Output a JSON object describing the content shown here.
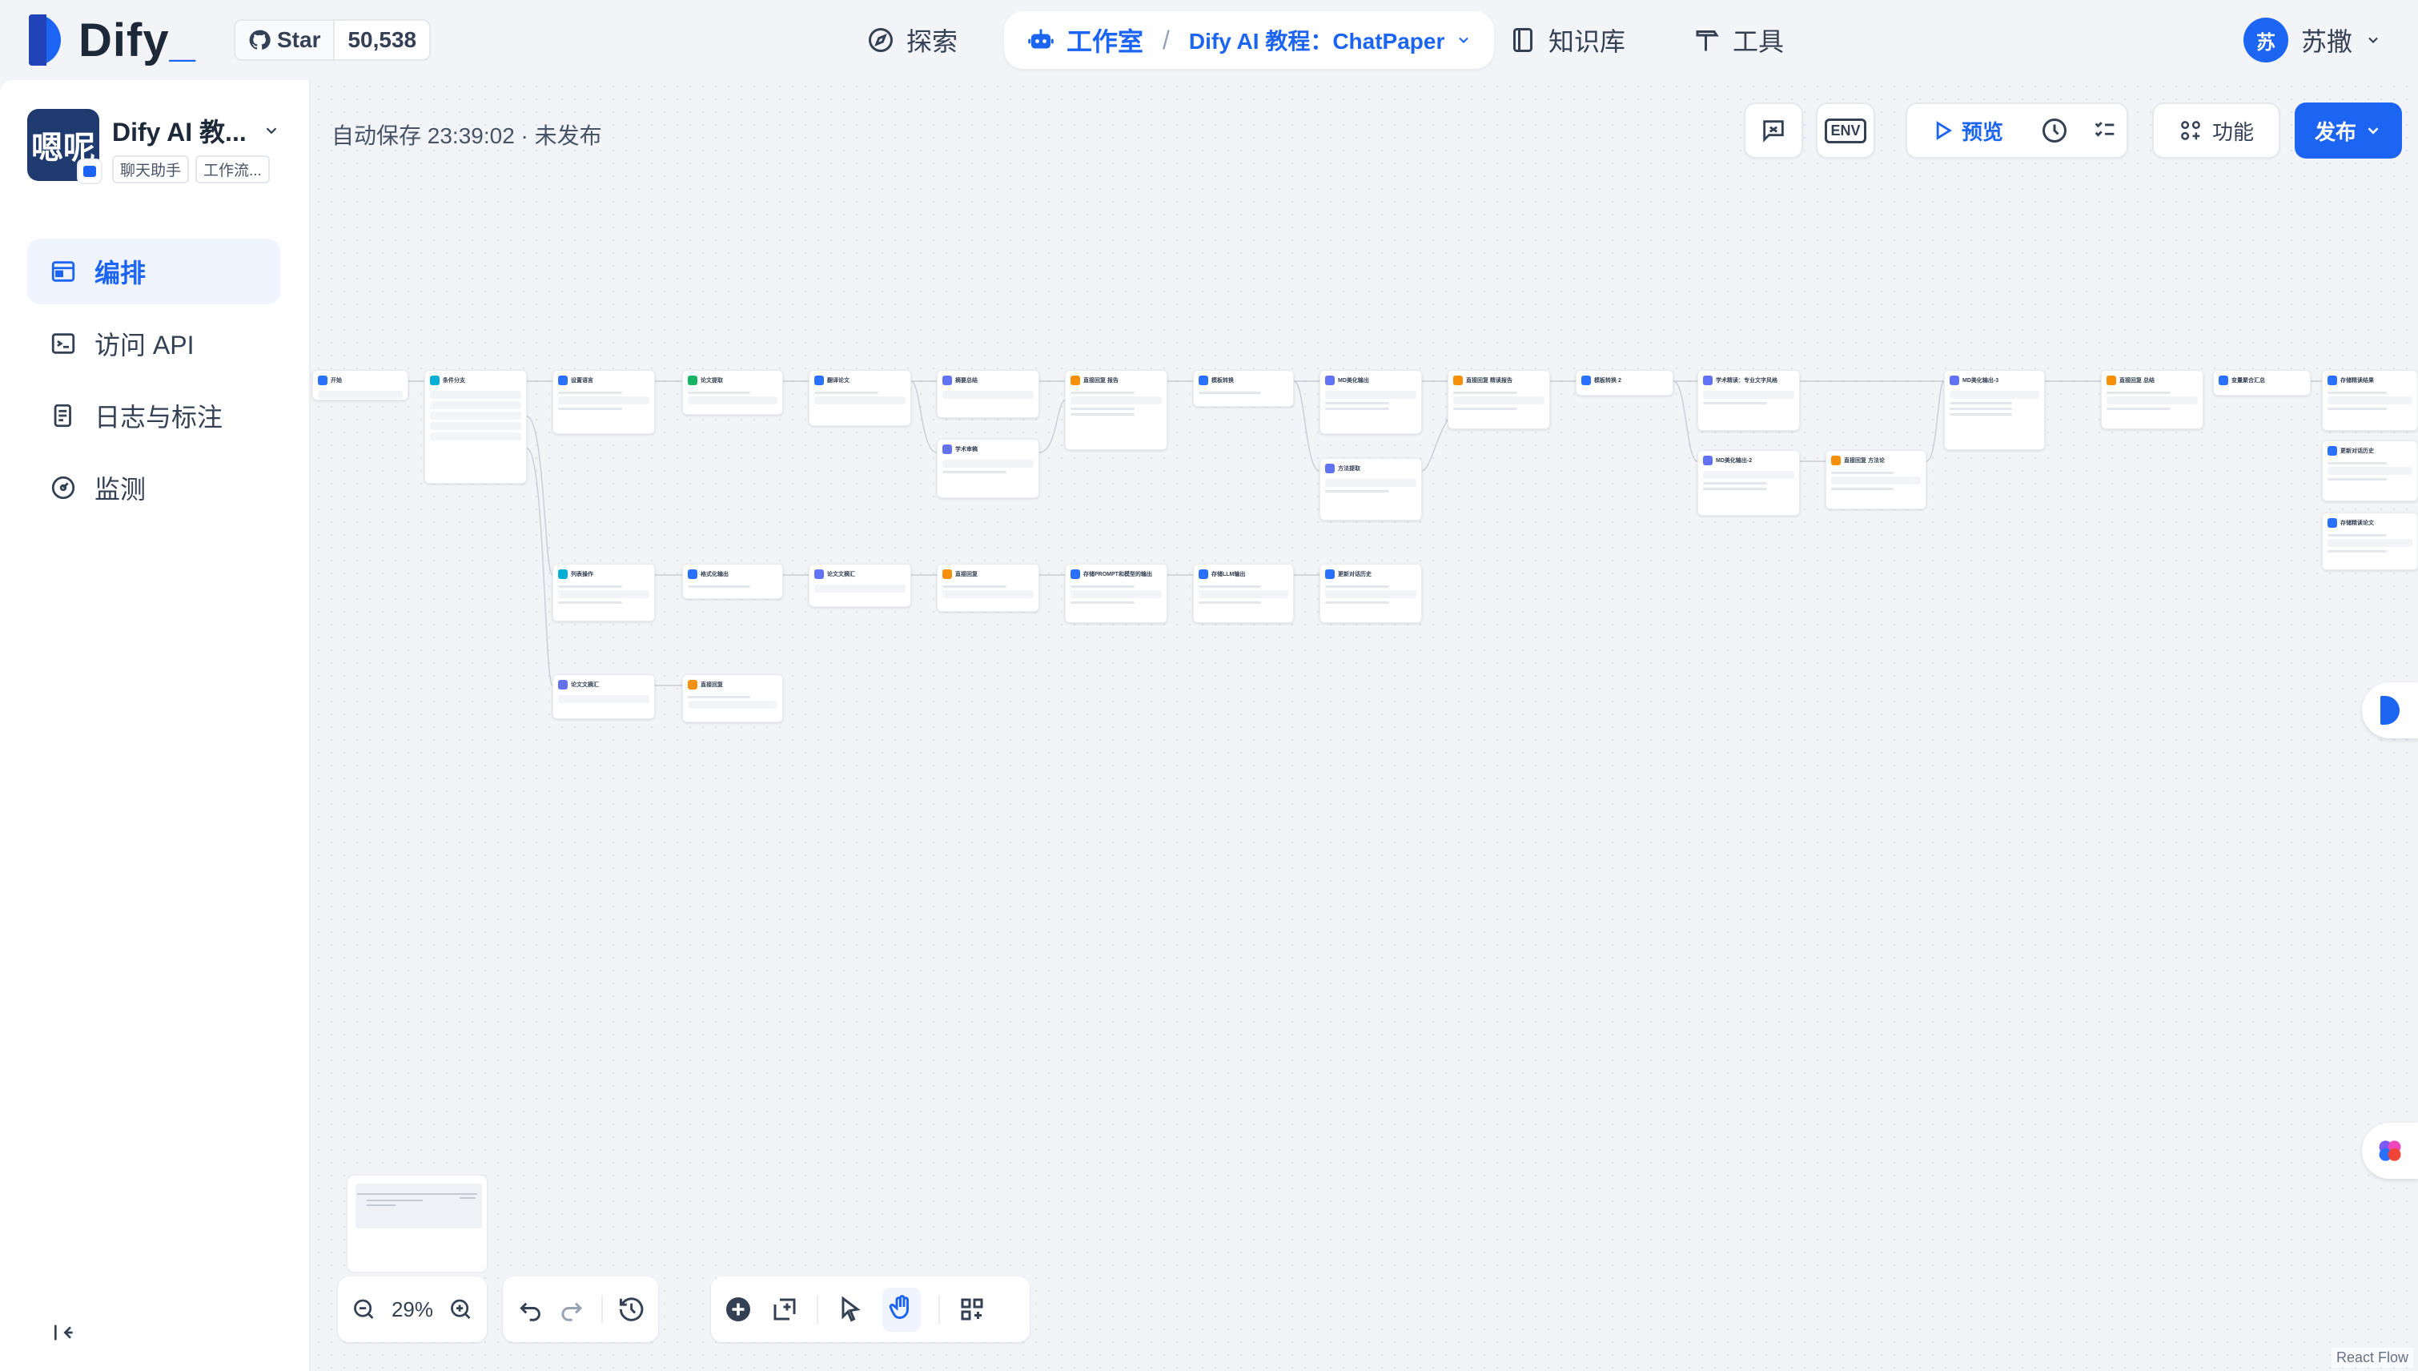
{
  "header": {
    "logo_text": "Dify",
    "github_star_label": "Star",
    "github_star_count": "50,538",
    "nav": {
      "explore": "探索",
      "studio": "工作室",
      "app_name": "Dify AI 教程：ChatPaper",
      "knowledge": "知识库",
      "tools": "工具"
    },
    "user": {
      "avatar_letter": "苏",
      "name": "苏撒"
    }
  },
  "sidebar": {
    "app": {
      "icon_text": "嗯呢",
      "title": "Dify AI 教...",
      "tags": [
        "聊天助手",
        "工作流..."
      ]
    },
    "items": [
      {
        "label": "编排",
        "icon": "layout-icon",
        "active": true
      },
      {
        "label": "访问 API",
        "icon": "terminal-icon",
        "active": false
      },
      {
        "label": "日志与标注",
        "icon": "log-icon",
        "active": false
      },
      {
        "label": "监测",
        "icon": "monitor-icon",
        "active": false
      }
    ]
  },
  "canvas": {
    "autosave": "自动保存 23:39:02 · 未发布",
    "toolbar": {
      "preview": "预览",
      "features": "功能",
      "publish": "发布"
    },
    "zoom": "29%",
    "attribution": "React Flow",
    "nodes": [
      {
        "title": "开始",
        "color": "#2970ff"
      },
      {
        "title": "条件分支",
        "color": "#06aed4"
      },
      {
        "title": "设置语言",
        "color": "#2970ff"
      },
      {
        "title": "论文提取",
        "color": "#16b364"
      },
      {
        "title": "翻译论文",
        "color": "#2970ff"
      },
      {
        "title": "摘要总结",
        "color": "#6172f3"
      },
      {
        "title": "直接回复 报告",
        "color": "#f79009"
      },
      {
        "title": "模板转换",
        "color": "#2970ff"
      },
      {
        "title": "MD美化输出",
        "color": "#6172f3"
      },
      {
        "title": "直接回复 精读报告",
        "color": "#f79009"
      },
      {
        "title": "模板转换 2",
        "color": "#2970ff"
      },
      {
        "title": "学术精读：专业文字风格",
        "color": "#6172f3"
      },
      {
        "title": "MD美化输出-3",
        "color": "#6172f3"
      },
      {
        "title": "直接回复 总结",
        "color": "#f79009"
      },
      {
        "title": "变量聚合汇总",
        "color": "#2970ff"
      },
      {
        "title": "存储精读结果",
        "color": "#2970ff"
      },
      {
        "title": "学术审稿",
        "color": "#6172f3"
      },
      {
        "title": "方法提取",
        "color": "#6172f3"
      },
      {
        "title": "MD美化输出-2",
        "color": "#6172f3"
      },
      {
        "title": "直接回复 方法论",
        "color": "#f79009"
      },
      {
        "title": "更新对话历史",
        "color": "#2970ff"
      },
      {
        "title": "存储精读论文",
        "color": "#2970ff"
      },
      {
        "title": "列表操作",
        "color": "#06aed4"
      },
      {
        "title": "格式化输出",
        "color": "#2970ff"
      },
      {
        "title": "论文文摘汇",
        "color": "#6172f3"
      },
      {
        "title": "直接回复",
        "color": "#f79009"
      },
      {
        "title": "存储PROMPT和模型的输出",
        "color": "#2970ff"
      },
      {
        "title": "存储LLM输出",
        "color": "#2970ff"
      },
      {
        "title": "更新对话历史",
        "color": "#2970ff"
      },
      {
        "title": "论文文摘汇",
        "color": "#6172f3"
      },
      {
        "title": "直接回复",
        "color": "#f79009"
      }
    ]
  }
}
